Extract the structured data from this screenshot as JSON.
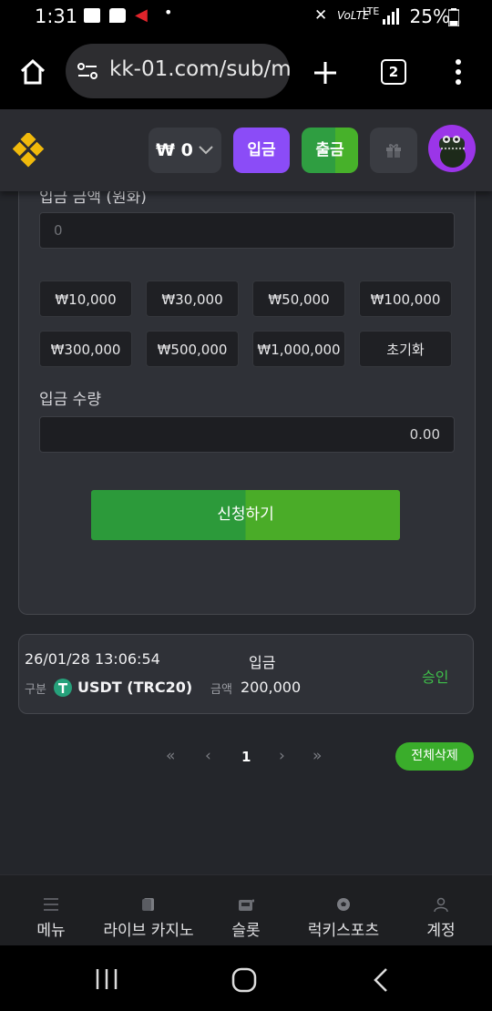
{
  "status_bar": {
    "time": "1:31",
    "battery": "25%"
  },
  "browser": {
    "url": "kk-01.com/sub/m",
    "tab_count": "2"
  },
  "header": {
    "currency_symbol": "₩",
    "balance": "0",
    "deposit_label": "입금",
    "withdraw_label": "출금"
  },
  "form": {
    "amount_label": "입금 금액 (원화)",
    "amount_placeholder": "0",
    "amount_buttons": [
      "₩10,000",
      "₩30,000",
      "₩50,000",
      "₩100,000",
      "₩300,000",
      "₩500,000",
      "₩1,000,000",
      "초기화"
    ],
    "quantity_label": "입금 수량",
    "quantity_value": "0.00",
    "submit_label": "신청하기"
  },
  "history": {
    "datetime": "26/01/28 13:06:54",
    "type": "입금",
    "category_label": "구분",
    "coin": "USDT (TRC20)",
    "amount_label": "금액",
    "amount": "200,000",
    "status": "승인",
    "status_color": "#3fc04a"
  },
  "pagination": {
    "first": "«",
    "prev": "‹",
    "page": "1",
    "next": "›",
    "last": "»",
    "delete_all_label": "전체삭제"
  },
  "bottom_nav": [
    {
      "label": "메뉴",
      "icon": "menu-icon"
    },
    {
      "label": "라이브 카지노",
      "icon": "cards-icon"
    },
    {
      "label": "슬롯",
      "icon": "slot-machine-icon"
    },
    {
      "label": "럭키스포츠",
      "icon": "soccer-ball-icon"
    },
    {
      "label": "계정",
      "icon": "user-icon"
    }
  ],
  "colors": {
    "accent_purple": "#8b4cf7",
    "accent_green": "#3aad2b"
  }
}
